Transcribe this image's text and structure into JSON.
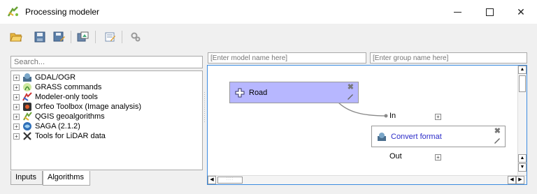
{
  "window": {
    "title": "Processing modeler"
  },
  "toolbar": {
    "buttons": [
      "open-folder-icon",
      "save-icon",
      "save-as-icon",
      "export-image-icon",
      "edit-help-icon",
      "run-model-icon"
    ]
  },
  "search": {
    "placeholder": "Search..."
  },
  "tree": {
    "items": [
      {
        "label": "GDAL/OGR",
        "icon": "gdal-icon"
      },
      {
        "label": "GRASS commands",
        "icon": "grass-icon"
      },
      {
        "label": "Modeler-only tools",
        "icon": "modeler-icon"
      },
      {
        "label": "Orfeo Toolbox (Image analysis)",
        "icon": "orfeo-icon"
      },
      {
        "label": "QGIS geoalgorithms",
        "icon": "qgis-icon"
      },
      {
        "label": "SAGA (2.1.2)",
        "icon": "saga-icon"
      },
      {
        "label": "Tools for LiDAR data",
        "icon": "lidar-icon"
      }
    ]
  },
  "tabs": {
    "inputs": "Inputs",
    "algorithms": "Algorithms",
    "active": "Algorithms"
  },
  "model": {
    "name_placeholder": "[Enter model name here]",
    "group_placeholder": "[Enter group name here]"
  },
  "canvas": {
    "nodes": {
      "road": {
        "label": "Road"
      },
      "convert": {
        "label": "Convert format",
        "in_label": "In",
        "out_label": "Out"
      }
    },
    "colors": {
      "input_node": "#b7b7ff",
      "algorithm_text": "#2b2bc8",
      "focus_border": "#3b8be0"
    }
  }
}
